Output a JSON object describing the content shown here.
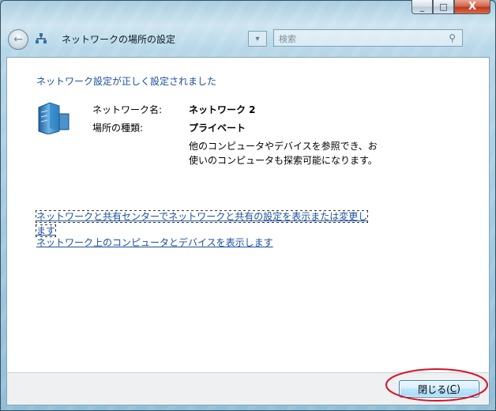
{
  "window": {
    "title": "ネットワークの場所の設定",
    "min_glyph": "_",
    "max_glyph": "□",
    "close_glyph": "X"
  },
  "nav": {
    "back_glyph": "←",
    "dropdown_glyph": "▾",
    "search_placeholder": "検索",
    "search_glyph": "⚲"
  },
  "main": {
    "heading": "ネットワーク設定が正しく設定されました",
    "network_name_label": "ネットワーク名:",
    "network_name_value": "ネットワーク 2",
    "location_type_label": "場所の種類:",
    "location_type_value": "プライベート",
    "description": "他のコンピュータやデバイスを参照でき、お使いのコンピュータも探索可能になります。",
    "link_sharing_center": "ネットワークと共有センターでネットワークと共有の設定を表示または変更します",
    "link_view_computers": "ネットワーク上のコンピュータとデバイスを表示します"
  },
  "footer": {
    "close_label": "閉じる(",
    "close_accesskey": "C",
    "close_label_end": ")",
    "highlight_color": "#d4142a"
  },
  "icons": {
    "title_icon": "network-icon",
    "server_icon": "network-server-icon"
  }
}
